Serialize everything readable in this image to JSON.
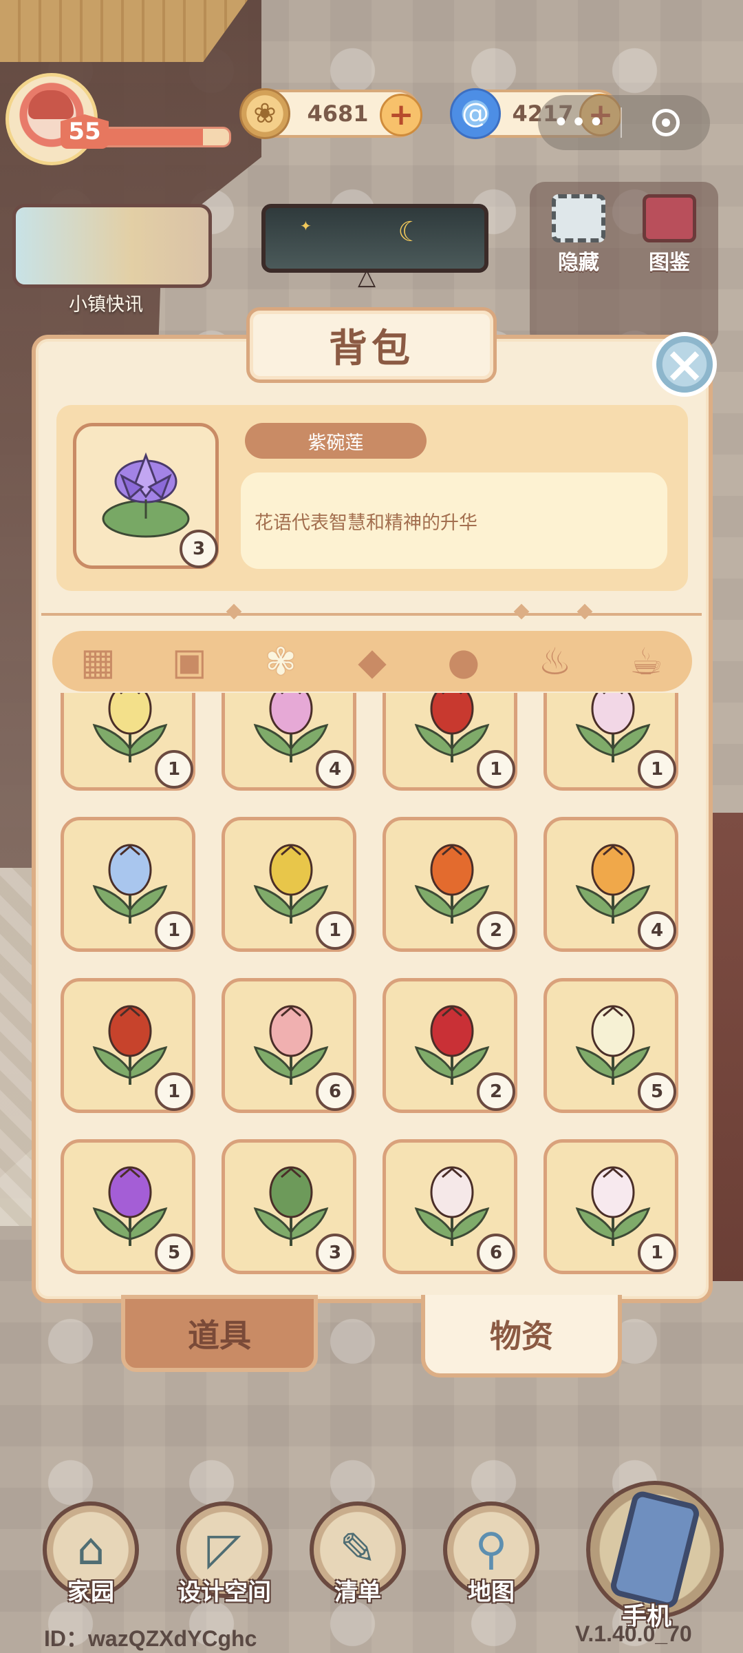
{
  "hud": {
    "level": "55",
    "xp_fraction": 0.8,
    "coins": "4681",
    "gems": "4217",
    "capsule_dots": "•••",
    "news_label": "小镇快讯",
    "side_buttons": [
      "隐藏",
      "图鉴"
    ]
  },
  "backpack": {
    "title": "背包",
    "selected": {
      "name": "紫碗莲",
      "count": "3",
      "description": "花语代表智慧和精神的升华"
    },
    "category_tabs": [
      {
        "icon": "grid-icon",
        "active": false
      },
      {
        "icon": "seed-icon",
        "active": false
      },
      {
        "icon": "flower-sprig-icon",
        "active": true
      },
      {
        "icon": "fish-icon",
        "active": false
      },
      {
        "icon": "drumstick-icon",
        "active": false
      },
      {
        "icon": "soup-bowl-icon",
        "active": false
      },
      {
        "icon": "tea-cup-icon",
        "active": false
      }
    ],
    "items": [
      {
        "flower": "yellow-lily",
        "color": "#f3e08a",
        "count": "1"
      },
      {
        "flower": "pink-hydrangea",
        "color": "#e6a9d6",
        "count": "4"
      },
      {
        "flower": "red-begonia",
        "color": "#c8392f",
        "count": "1"
      },
      {
        "flower": "white-lily",
        "color": "#f2d7e6",
        "count": "1"
      },
      {
        "flower": "blue-peony",
        "color": "#a9c6ee",
        "count": "1"
      },
      {
        "flower": "yellow-primrose",
        "color": "#e8c64a",
        "count": "1"
      },
      {
        "flower": "orange-red-tulip",
        "color": "#e36b2e",
        "count": "2"
      },
      {
        "flower": "orange-tulip",
        "color": "#f0a84a",
        "count": "4"
      },
      {
        "flower": "red-amaryllis",
        "color": "#c7432c",
        "count": "1"
      },
      {
        "flower": "pink-tulip",
        "color": "#f0b0b0",
        "count": "6"
      },
      {
        "flower": "red-tulip",
        "color": "#c93036",
        "count": "2"
      },
      {
        "flower": "white-narcissus",
        "color": "#f6f1d4",
        "count": "5"
      },
      {
        "flower": "purple-calla",
        "color": "#a45ed6",
        "count": "5"
      },
      {
        "flower": "caladium",
        "color": "#6d9a5a",
        "count": "3"
      },
      {
        "flower": "white-anthurium",
        "color": "#f5e8e8",
        "count": "6"
      },
      {
        "flower": "white-jasmine",
        "color": "#f7e9ee",
        "count": "1"
      }
    ],
    "bottom_tabs": {
      "tools": "道具",
      "materials": "物资",
      "active": "materials"
    }
  },
  "nav": {
    "items": [
      {
        "label": "家园",
        "icon": "house-icon"
      },
      {
        "label": "设计空间",
        "icon": "ruler-icon"
      },
      {
        "label": "清单",
        "icon": "list-icon"
      },
      {
        "label": "地图",
        "icon": "map-pin-icon"
      }
    ],
    "phone_label": "手机"
  },
  "footer": {
    "id": "ID：wazQZXdYCghc",
    "version": "V.1.40.0_70"
  }
}
